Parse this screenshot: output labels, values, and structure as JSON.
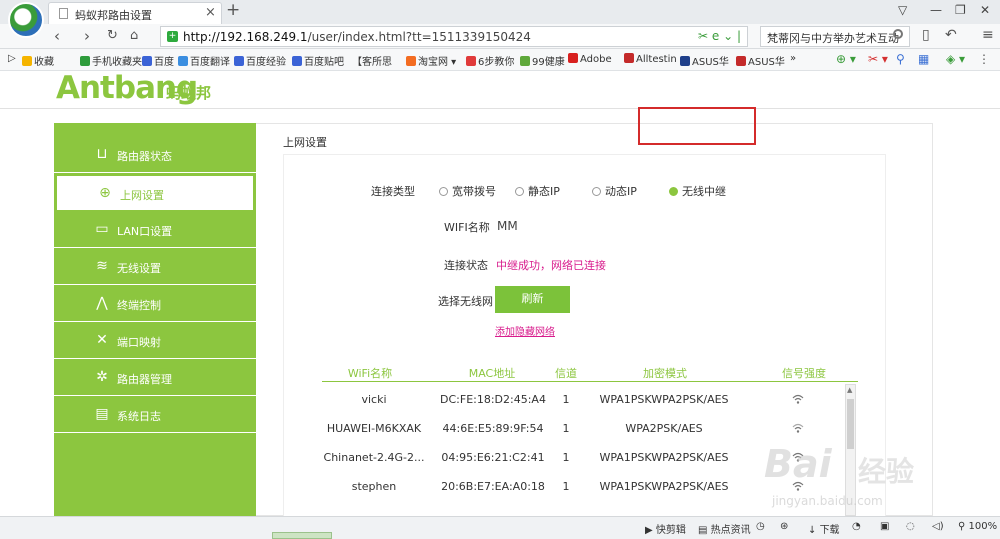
{
  "browser": {
    "tab_title": "蚂蚁邦路由设置",
    "tab_close": "×",
    "new_tab": "+",
    "url_host": "http://192.168.249.1",
    "url_path": "/user/index.html?tt=1511339150424",
    "search_text": "梵蒂冈与中方举办艺术互动",
    "bookmarks": [
      "收藏",
      "手机收藏夹",
      "百度",
      "百度翻译",
      "百度经验",
      "百度贴吧",
      "【客所思",
      "淘宝网",
      "6步教你",
      "99健康",
      "Adobe",
      "Alltestin",
      "ASUS华",
      "ASUS华"
    ],
    "status_items": [
      "快剪辑",
      "热点资讯",
      "下载",
      "100%"
    ]
  },
  "brand": {
    "name": "Antbang",
    "name_cn": "蚂蚁邦"
  },
  "sidebar": {
    "items": [
      {
        "label": "路由器状态",
        "icon": "router-status-icon"
      },
      {
        "label": "上网设置",
        "icon": "globe-icon"
      },
      {
        "label": "LAN口设置",
        "icon": "lan-port-icon"
      },
      {
        "label": "无线设置",
        "icon": "wifi-icon"
      },
      {
        "label": "终端控制",
        "icon": "terminal-control-icon"
      },
      {
        "label": "端口映射",
        "icon": "tools-icon"
      },
      {
        "label": "路由器管理",
        "icon": "gear-icon"
      },
      {
        "label": "系统日志",
        "icon": "log-icon"
      }
    ],
    "active_index": 1
  },
  "main": {
    "title": "上网设置",
    "connection_type_label": "连接类型",
    "connection_types": [
      "宽带拨号",
      "静态IP",
      "动态IP",
      "无线中继"
    ],
    "selected_connection": "无线中继",
    "wifi_name_label": "WIFI名称",
    "wifi_name_value": "MM",
    "connection_status_label": "连接状态",
    "connection_status_value": "中继成功，网络已连接",
    "select_network_label": "选择无线网",
    "refresh_button": "刷新",
    "add_hidden_network": "添加隐藏网络",
    "table": {
      "headers": [
        "WiFi名称",
        "MAC地址",
        "信道",
        "加密模式",
        "信号强度"
      ],
      "rows": [
        {
          "ssid": "vicki",
          "mac": "DC:FE:18:D2:45:A4",
          "channel": "1",
          "encryption": "WPA1PSKWPA2PSK/AES"
        },
        {
          "ssid": "HUAWEI-M6KXAK",
          "mac": "44:6E:E5:89:9F:54",
          "channel": "1",
          "encryption": "WPA2PSK/AES"
        },
        {
          "ssid": "Chinanet-2.4G-2...",
          "mac": "04:95:E6:21:C2:41",
          "channel": "1",
          "encryption": "WPA1PSKWPA2PSK/AES"
        },
        {
          "ssid": "stephen",
          "mac": "20:6B:E7:EA:A0:18",
          "channel": "1",
          "encryption": "WPA1PSKWPA2PSK/AES"
        }
      ]
    }
  },
  "watermark": {
    "logo": "Bai",
    "text": "经验",
    "url": "jingyan.baidu.com"
  },
  "colors": {
    "brand_green": "#8cc63f",
    "button_green": "#7cc23a",
    "status_magenta": "#d81b8c",
    "highlight_red": "#d42b2b"
  }
}
